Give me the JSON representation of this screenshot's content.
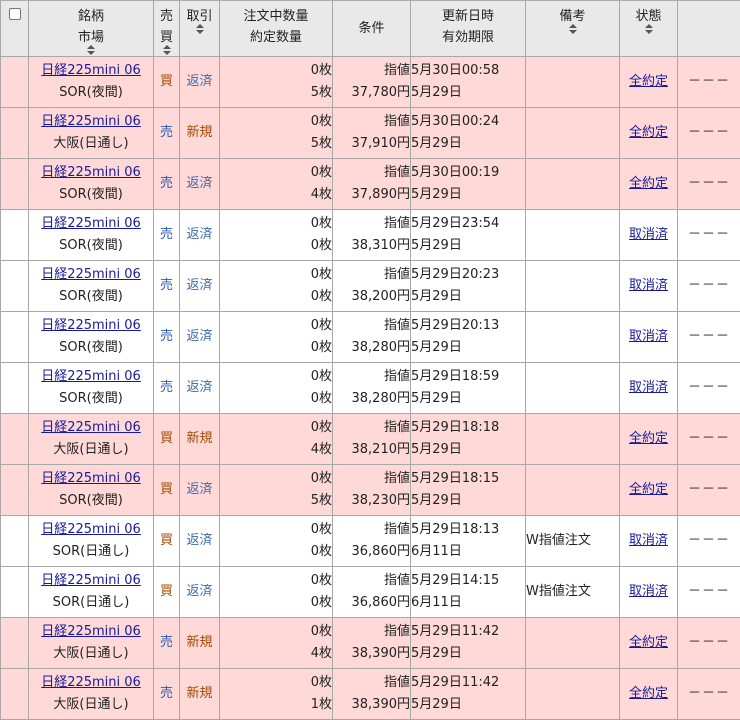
{
  "header": {
    "name_line1": "銘柄",
    "name_line2": "市場",
    "side_line1": "売",
    "side_line2": "買",
    "trade": "取引",
    "qty_line1": "注文中数量",
    "qty_line2": "約定数量",
    "condition": "条件",
    "time_line1": "更新日時",
    "time_line2": "有効期限",
    "note": "備考",
    "status": "状態"
  },
  "rows": [
    {
      "filled": true,
      "name": "日経225mini 06",
      "market": "SOR(夜間)",
      "side": "買",
      "trade": "返済",
      "qty_open": "0枚",
      "qty_filled": "5枚",
      "cond_type": "指値",
      "price": "37,780円",
      "updated": "5月30日00:58",
      "expiry": "5月29日",
      "note": "",
      "status": "全約定",
      "extra": "－－－"
    },
    {
      "filled": true,
      "name": "日経225mini 06",
      "market": "大阪(日通し)",
      "side": "売",
      "trade": "新規",
      "qty_open": "0枚",
      "qty_filled": "5枚",
      "cond_type": "指値",
      "price": "37,910円",
      "updated": "5月30日00:24",
      "expiry": "5月29日",
      "note": "",
      "status": "全約定",
      "extra": "－－－"
    },
    {
      "filled": true,
      "name": "日経225mini 06",
      "market": "SOR(夜間)",
      "side": "売",
      "trade": "返済",
      "qty_open": "0枚",
      "qty_filled": "4枚",
      "cond_type": "指値",
      "price": "37,890円",
      "updated": "5月30日00:19",
      "expiry": "5月29日",
      "note": "",
      "status": "全約定",
      "extra": "－－－"
    },
    {
      "filled": false,
      "name": "日経225mini 06",
      "market": "SOR(夜間)",
      "side": "売",
      "trade": "返済",
      "qty_open": "0枚",
      "qty_filled": "0枚",
      "cond_type": "指値",
      "price": "38,310円",
      "updated": "5月29日23:54",
      "expiry": "5月29日",
      "note": "",
      "status": "取消済",
      "extra": "－－－"
    },
    {
      "filled": false,
      "name": "日経225mini 06",
      "market": "SOR(夜間)",
      "side": "売",
      "trade": "返済",
      "qty_open": "0枚",
      "qty_filled": "0枚",
      "cond_type": "指値",
      "price": "38,200円",
      "updated": "5月29日20:23",
      "expiry": "5月29日",
      "note": "",
      "status": "取消済",
      "extra": "－－－"
    },
    {
      "filled": false,
      "name": "日経225mini 06",
      "market": "SOR(夜間)",
      "side": "売",
      "trade": "返済",
      "qty_open": "0枚",
      "qty_filled": "0枚",
      "cond_type": "指値",
      "price": "38,280円",
      "updated": "5月29日20:13",
      "expiry": "5月29日",
      "note": "",
      "status": "取消済",
      "extra": "－－－"
    },
    {
      "filled": false,
      "name": "日経225mini 06",
      "market": "SOR(夜間)",
      "side": "売",
      "trade": "返済",
      "qty_open": "0枚",
      "qty_filled": "0枚",
      "cond_type": "指値",
      "price": "38,280円",
      "updated": "5月29日18:59",
      "expiry": "5月29日",
      "note": "",
      "status": "取消済",
      "extra": "－－－"
    },
    {
      "filled": true,
      "name": "日経225mini 06",
      "market": "大阪(日通し)",
      "side": "買",
      "trade": "新規",
      "qty_open": "0枚",
      "qty_filled": "4枚",
      "cond_type": "指値",
      "price": "38,210円",
      "updated": "5月29日18:18",
      "expiry": "5月29日",
      "note": "",
      "status": "全約定",
      "extra": "－－－"
    },
    {
      "filled": true,
      "name": "日経225mini 06",
      "market": "SOR(夜間)",
      "side": "買",
      "trade": "返済",
      "qty_open": "0枚",
      "qty_filled": "5枚",
      "cond_type": "指値",
      "price": "38,230円",
      "updated": "5月29日18:15",
      "expiry": "5月29日",
      "note": "",
      "status": "全約定",
      "extra": "－－－"
    },
    {
      "filled": false,
      "name": "日経225mini 06",
      "market": "SOR(日通し)",
      "side": "買",
      "trade": "返済",
      "qty_open": "0枚",
      "qty_filled": "0枚",
      "cond_type": "指値",
      "price": "36,860円",
      "updated": "5月29日18:13",
      "expiry": "6月11日",
      "note": "W指値注文",
      "status": "取消済",
      "extra": "－－－"
    },
    {
      "filled": false,
      "name": "日経225mini 06",
      "market": "SOR(日通し)",
      "side": "買",
      "trade": "返済",
      "qty_open": "0枚",
      "qty_filled": "0枚",
      "cond_type": "指値",
      "price": "36,860円",
      "updated": "5月29日14:15",
      "expiry": "6月11日",
      "note": "W指値注文",
      "status": "取消済",
      "extra": "－－－"
    },
    {
      "filled": true,
      "name": "日経225mini 06",
      "market": "大阪(日通し)",
      "side": "売",
      "trade": "新規",
      "qty_open": "0枚",
      "qty_filled": "4枚",
      "cond_type": "指値",
      "price": "38,390円",
      "updated": "5月29日11:42",
      "expiry": "5月29日",
      "note": "",
      "status": "全約定",
      "extra": "－－－"
    },
    {
      "filled": true,
      "name": "日経225mini 06",
      "market": "大阪(日通し)",
      "side": "売",
      "trade": "新規",
      "qty_open": "0枚",
      "qty_filled": "1枚",
      "cond_type": "指値",
      "price": "38,390円",
      "updated": "5月29日11:42",
      "expiry": "5月29日",
      "note": "",
      "status": "全約定",
      "extra": "－－－"
    }
  ]
}
